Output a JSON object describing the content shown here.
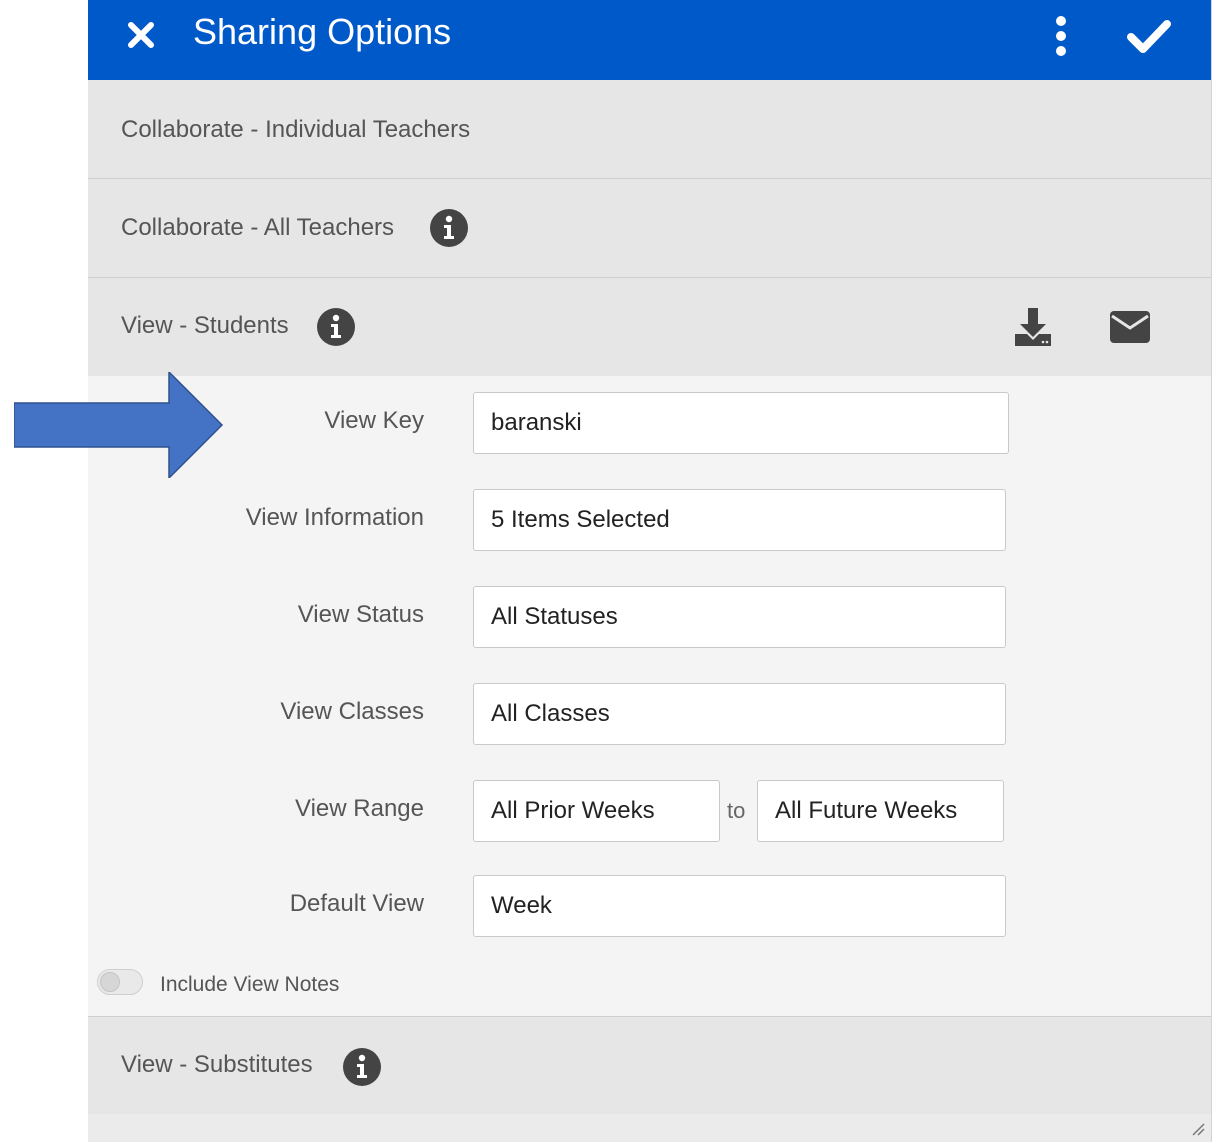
{
  "header": {
    "title": "Sharing Options",
    "bg_color": "#0059c9"
  },
  "sections": {
    "individual": {
      "label": "Collaborate - Individual Teachers"
    },
    "all_teachers": {
      "label": "Collaborate - All Teachers"
    },
    "students": {
      "label": "View - Students"
    },
    "substitutes": {
      "label": "View - Substitutes"
    }
  },
  "form": {
    "view_key": {
      "label": "View Key",
      "value": "baranski"
    },
    "view_information": {
      "label": "View Information",
      "value": "5 Items Selected"
    },
    "view_status": {
      "label": "View Status",
      "value": "All Statuses"
    },
    "view_classes": {
      "label": "View Classes",
      "value": "All Classes"
    },
    "view_range": {
      "label": "View Range",
      "from": "All Prior Weeks",
      "separator": "to",
      "to": "All Future Weeks"
    },
    "default_view": {
      "label": "Default View",
      "value": "Week"
    },
    "include_notes": {
      "label": "Include View Notes",
      "enabled": false
    }
  },
  "icons": {
    "close": "close-icon",
    "more": "more-vertical-icon",
    "check": "check-icon",
    "info": "info-icon",
    "download": "download-icon",
    "email": "envelope-icon",
    "annotation_arrow": "arrow-right-icon"
  },
  "colors": {
    "arrow": "#4472c4",
    "section_bg": "#e6e6e6",
    "panel_bg": "#f4f4f4"
  }
}
